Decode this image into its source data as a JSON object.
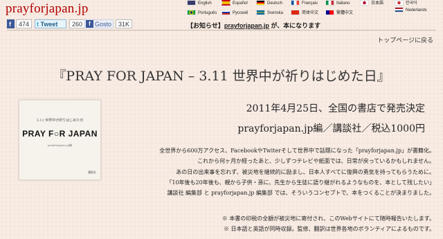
{
  "logo": "prayforjapan.jp",
  "social": {
    "facebook_count": "474",
    "tweet_label": "Tweet",
    "tweet_count": "260",
    "gosto_label": "Gosto",
    "gosto_count": "31K"
  },
  "languages": [
    {
      "label": "English",
      "flag": "#3c3b6e"
    },
    {
      "label": "Español",
      "flag": "#c60b1e"
    },
    {
      "label": "Deutsch",
      "flag": "#000000"
    },
    {
      "label": "Français",
      "flag": "#0055a4"
    },
    {
      "label": "Italiano",
      "flag": "#009246"
    },
    {
      "label": "日本語",
      "flag": "#ffffff"
    },
    {
      "label": "한국어",
      "flag": "#ffffff"
    },
    {
      "label": "Português",
      "flag": "#009c3b"
    },
    {
      "label": "Русский",
      "flag": "#ffffff"
    },
    {
      "label": "Svenska",
      "flag": "#006aa7"
    },
    {
      "label": "简体中文",
      "flag": "#de2910"
    },
    {
      "label": "繁體中文",
      "flag": "#fe0000"
    },
    {
      "label": "Nederlands",
      "flag": "#ae1c28"
    }
  ],
  "notice": {
    "prefix": "【お知らせ】",
    "link": "prayforjapan.jp",
    "suffix": " が、本になります"
  },
  "top_link": "トップページに戻る",
  "title": "『PRAY FOR JAPAN – 3.11 世界中が祈りはじめた日』",
  "book_cover": {
    "small": "3.11 世界中が祈りはじめた日",
    "big": "PRAY F○R JAPAN",
    "pub": "prayforjapan.jp編",
    "kodansha": "講談社"
  },
  "release": "2011年4月25日、全国の書店で発売決定",
  "edition": "prayforjapan.jp編／講談社／税込1000円",
  "body_lines": [
    "全世界から600万アクセス、FacebookやTwiterそして世界中で話題になった「prayforjapan.jp」が書籍化。",
    "これから何ヶ月か経ったあと、少しずつテレビや紙面では、日常が戻っているかもしれません。",
    "あの日の出来事を忘れず、被災地を継続的に励まし、日本人すべてに復興の勇気を持ってもらうために。",
    "「10年後も20年後も、親から子供・孫に、先生から生徒に語り継がれるようなものを、本として残したい」",
    "講談社 編集部 と prayforjapan.jp 編集部 では、そういうコンセプトで、本をつくることが決まりました。"
  ],
  "notes": [
    "※ 本書の印税の全額が被災地に寄付され、このWebサイトにて随時報告いたします。",
    "※ 日本語と英語が同時収録。監修、翻訳は世界各地のボランティアによるものです。"
  ]
}
